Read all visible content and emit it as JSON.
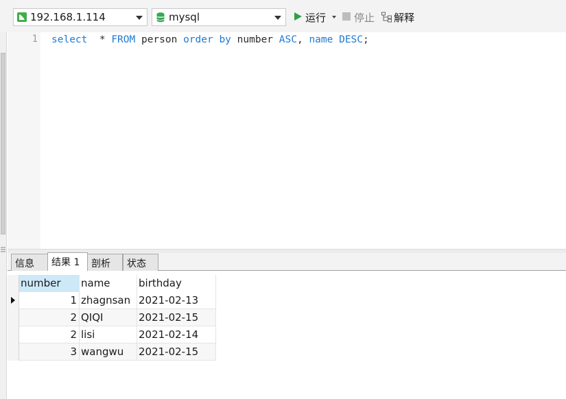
{
  "toolbar": {
    "connection": "192.168.1.114",
    "database": "mysql",
    "run_label": "运行",
    "stop_label": "停止",
    "explain_label": "解释",
    "icons": [
      "connection-icon",
      "database-icon",
      "run-icon",
      "stop-icon",
      "explain-icon"
    ]
  },
  "editor": {
    "line_numbers": [
      "1"
    ],
    "tokens": [
      {
        "text": "select",
        "kind": "kw"
      },
      {
        "text": "  * ",
        "kind": "id"
      },
      {
        "text": "FROM",
        "kind": "kw"
      },
      {
        "text": " person ",
        "kind": "id"
      },
      {
        "text": "order by",
        "kind": "kw"
      },
      {
        "text": " number ",
        "kind": "id"
      },
      {
        "text": "ASC",
        "kind": "kw"
      },
      {
        "text": ", ",
        "kind": "id"
      },
      {
        "text": "name",
        "kind": "kw"
      },
      {
        "text": " ",
        "kind": "id"
      },
      {
        "text": "DESC",
        "kind": "kw"
      },
      {
        "text": ";",
        "kind": "id"
      }
    ]
  },
  "tabs": [
    {
      "label": "信息",
      "active": false
    },
    {
      "label": "结果 1",
      "active": true
    },
    {
      "label": "剖析",
      "active": false
    },
    {
      "label": "状态",
      "active": false
    }
  ],
  "results": {
    "columns": [
      "number",
      "name",
      "birthday"
    ],
    "rows": [
      [
        "1",
        "zhagnsan",
        "2021-02-13"
      ],
      [
        "2",
        "QIQI",
        "2021-02-15"
      ],
      [
        "2",
        "lisi",
        "2021-02-14"
      ],
      [
        "3",
        "wangwu",
        "2021-02-15"
      ]
    ],
    "selected_row": 0
  },
  "colors": {
    "keyword": "#1e7ad3",
    "run_green": "#2ea043",
    "header_highlight": "#cde9f8"
  }
}
